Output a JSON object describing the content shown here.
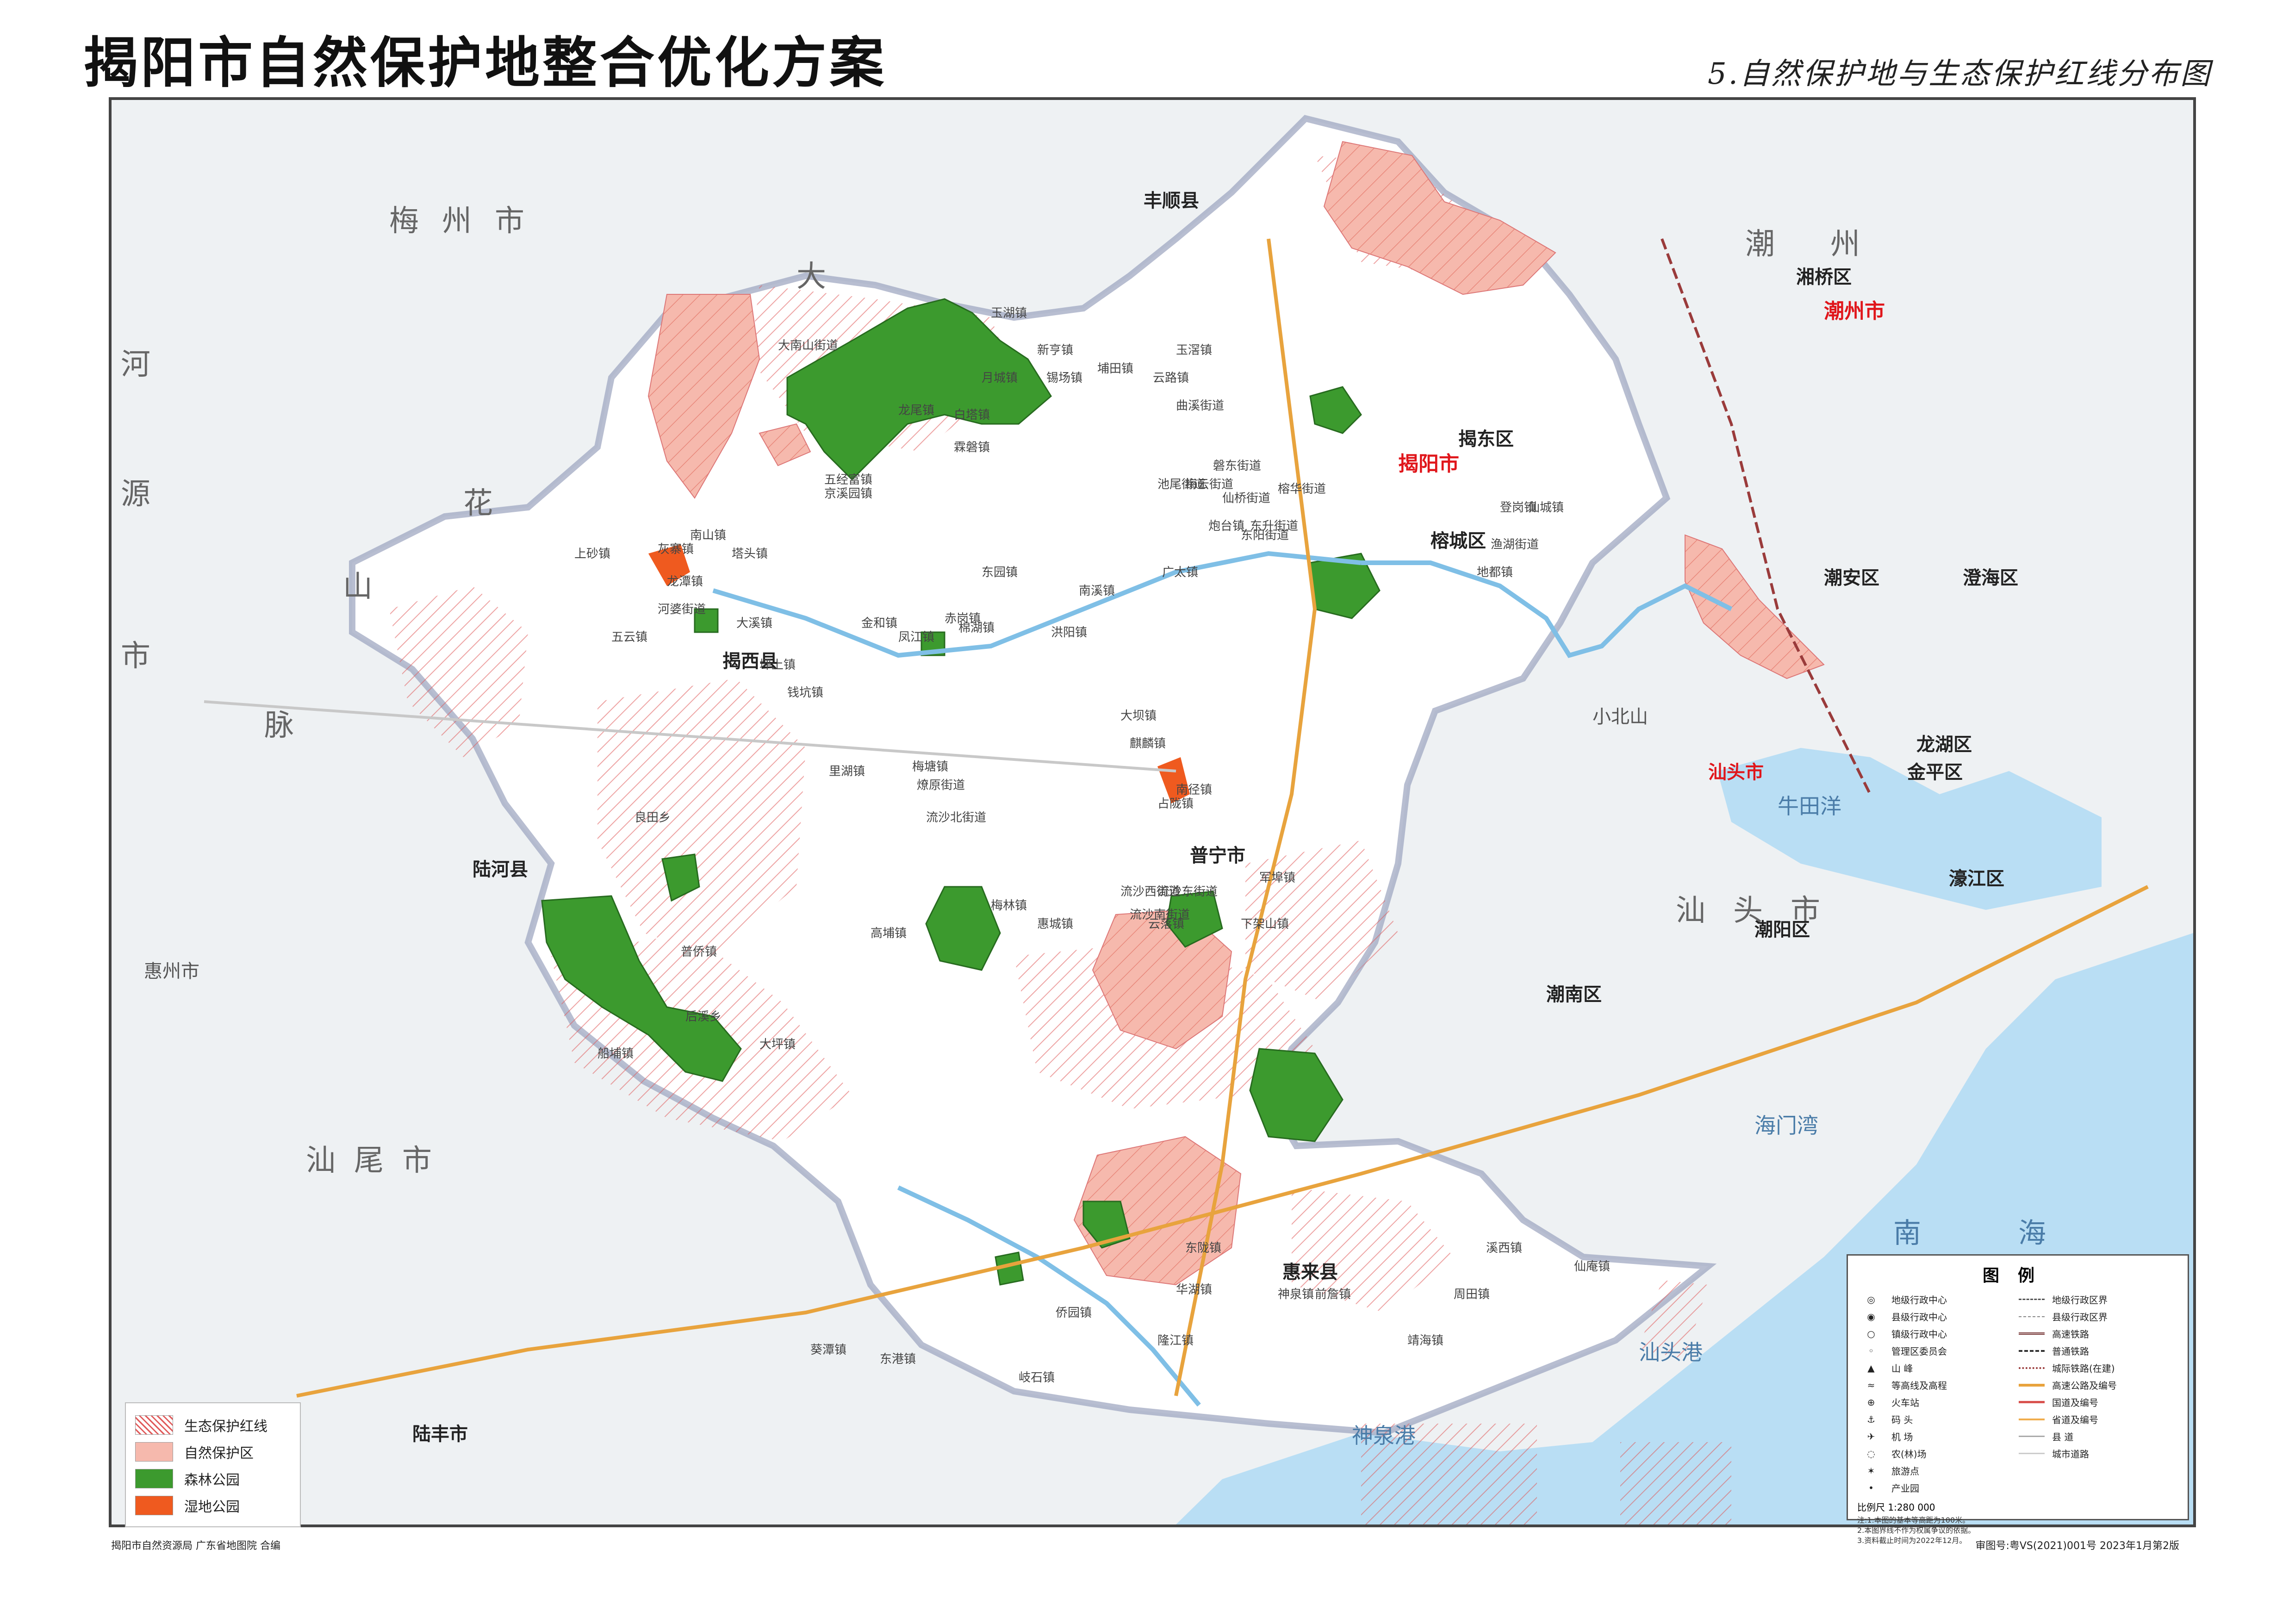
{
  "header": {
    "title": "揭阳市自然保护地整合优化方案",
    "subtitle": "5.自然保护地与生态保护红线分布图"
  },
  "colors": {
    "county_fill": "#ffffff",
    "outside_fill": "#eef1f3",
    "sea": "#b9def4",
    "redline": "#e05a5a",
    "nature_reserve": "#f6b9ad",
    "forest_park": "#3c9a2e",
    "wetland_park": "#ef5a1f",
    "city_red": "#e0161b"
  },
  "map_labels": {
    "regions": [
      "梅州市",
      "大",
      "花",
      "源",
      "河",
      "山",
      "脉",
      "市",
      "惠州市",
      "汕尾市",
      "陆丰市",
      "陆河县",
      "丰顺县",
      "潮州市",
      "汕头市",
      "潮州",
      "小北山"
    ],
    "counties": [
      "揭阳市",
      "揭西县",
      "普宁市",
      "惠来县",
      "揭东区",
      "榕城区",
      "潮安区",
      "湘桥区",
      "澄海区",
      "龙湖区",
      "金平区",
      "濠江区",
      "潮阳区",
      "潮南区"
    ],
    "towns": [
      "玉湖镇",
      "新亨镇",
      "锡场镇",
      "埔田镇",
      "云路镇",
      "玉滘镇",
      "曲溪街道",
      "月城镇",
      "白塔镇",
      "霖磐镇",
      "炮台镇",
      "地都镇",
      "登岗镇",
      "仙城镇",
      "京溪园镇",
      "五经富镇",
      "龙尾镇",
      "南山镇",
      "灰寨镇",
      "塔头镇",
      "龙潭镇",
      "河婆街道",
      "五云镇",
      "上砂镇",
      "坪上镇",
      "钱坑镇",
      "大溪镇",
      "金和镇",
      "凤江镇",
      "棉湖镇",
      "赤岗镇",
      "洪阳镇",
      "里湖镇",
      "梅塘镇",
      "燎原街道",
      "流沙北街道",
      "南径镇",
      "麒麟镇",
      "大坝镇",
      "占陇镇",
      "军埠镇",
      "下架山镇",
      "云落镇",
      "梅林镇",
      "高埔镇",
      "大坪镇",
      "后溪乡",
      "船埔镇",
      "普侨镇",
      "良田乡",
      "大南山街道",
      "惠城镇",
      "东陇镇",
      "华湖镇",
      "神泉镇",
      "前詹镇",
      "靖海镇",
      "周田镇",
      "溪西镇",
      "隆江镇",
      "侨园镇",
      "岐石镇",
      "东港镇",
      "葵潭镇",
      "仙庵镇",
      "东园镇",
      "广太镇",
      "南溪镇",
      "渔湖街道",
      "梅云街道",
      "磐东街道",
      "仙桥街道",
      "榕华街道",
      "东升街道",
      "东阳街道",
      "池尾街道",
      "流沙东街道",
      "流沙西街道",
      "流沙南街道"
    ],
    "seas": [
      "海门湾",
      "南",
      "海",
      "汕头港",
      "神泉港",
      "牛田洋"
    ]
  },
  "legend_left": [
    {
      "label": "生态保护红线",
      "key": "redline"
    },
    {
      "label": "自然保护区",
      "key": "nature_reserve"
    },
    {
      "label": "森林公园",
      "key": "forest_park"
    },
    {
      "label": "湿地公园",
      "key": "wetland_park"
    }
  ],
  "legend_right": {
    "title": "图例",
    "left_items": [
      {
        "icon": "prefecture-center-icon",
        "glyph": "◎",
        "label": "地级行政中心"
      },
      {
        "icon": "county-center-icon",
        "glyph": "◉",
        "label": "县级行政中心"
      },
      {
        "icon": "town-center-icon",
        "glyph": "○",
        "label": "镇级行政中心"
      },
      {
        "icon": "admin-committee-icon",
        "glyph": "◦",
        "label": "管理区委员会"
      },
      {
        "icon": "peak-icon",
        "glyph": "▲",
        "label": "山  峰"
      },
      {
        "icon": "contour-icon",
        "glyph": "≈",
        "label": "等高线及高程"
      },
      {
        "icon": "train-station-icon",
        "glyph": "⊕",
        "label": "火车站"
      },
      {
        "icon": "port-icon",
        "glyph": "⚓",
        "label": "码  头"
      },
      {
        "icon": "airport-icon",
        "glyph": "✈",
        "label": "机  场"
      },
      {
        "icon": "farm-icon",
        "glyph": "◌",
        "label": "农(林)场"
      },
      {
        "icon": "scenic-spot-icon",
        "glyph": "✶",
        "label": "旅游点"
      },
      {
        "icon": "industrial-park-icon",
        "glyph": "•",
        "label": "产业园"
      }
    ],
    "right_items": [
      {
        "icon": "prefecture-boundary-icon",
        "label": "地级行政区界"
      },
      {
        "icon": "county-boundary-icon",
        "label": "县级行政区界"
      },
      {
        "icon": "high-speed-rail-icon",
        "label": "高速铁路"
      },
      {
        "icon": "railway-icon",
        "label": "普通铁路"
      },
      {
        "icon": "intercity-rail-icon",
        "label": "城际铁路(在建)"
      },
      {
        "icon": "expressway-icon",
        "label": "高速公路及编号"
      },
      {
        "icon": "national-road-icon",
        "label": "国道及编号"
      },
      {
        "icon": "provincial-road-icon",
        "label": "省道及编号"
      },
      {
        "icon": "county-road-icon",
        "label": "县  道"
      },
      {
        "icon": "city-road-icon",
        "label": "城市道路"
      }
    ],
    "scale": "比例尺  1:280 000",
    "notes": [
      "注:1.本图的基本等高距为100米。",
      "2.本图界线不作为权属争议的依据。",
      "3.资料截止时间为2022年12月。"
    ]
  },
  "footer": {
    "left": "揭阳市自然资源局  广东省地图院  合编",
    "right": "审图号:粤VS(2021)001号    2023年1月第2版"
  }
}
